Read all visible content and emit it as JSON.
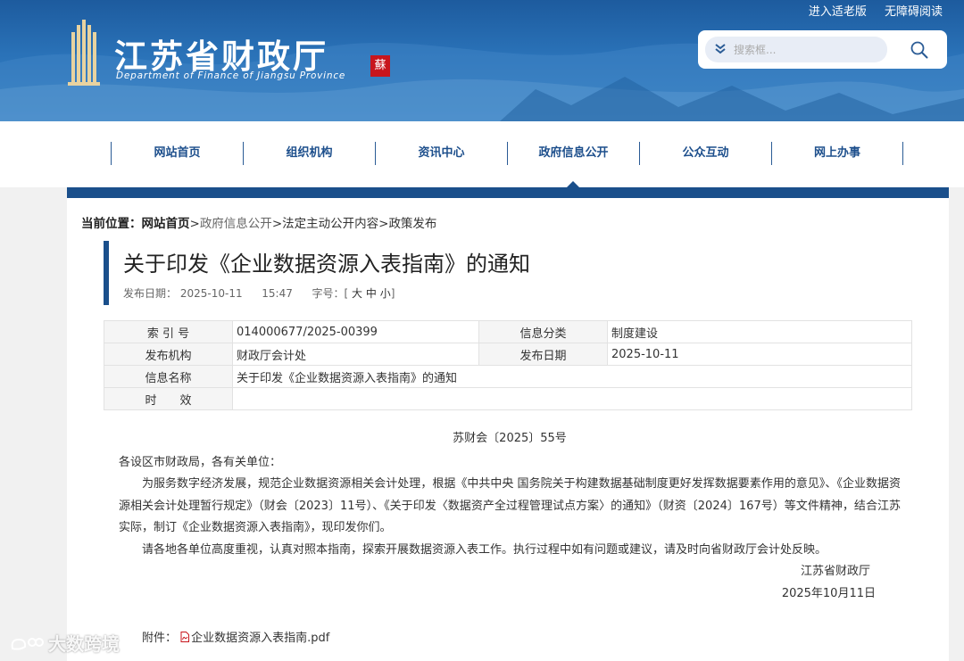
{
  "header": {
    "top_links": [
      "进入适老版",
      "无障碍阅读"
    ],
    "site_title": "江苏省财政厅",
    "site_subtitle": "Department of Finance of Jiangsu Province",
    "seal_char": "蘇",
    "search_placeholder": "搜索框..."
  },
  "nav": {
    "items": [
      "网站首页",
      "组织机构",
      "资讯中心",
      "政府信息公开",
      "公众互动",
      "网上办事"
    ],
    "active_index": 3
  },
  "breadcrumb": {
    "label": "当前位置：",
    "home": "网站首页",
    "sep": ">",
    "items": [
      "政府信息公开",
      "法定主动公开内容",
      "政策发布"
    ]
  },
  "article": {
    "title": "关于印发《企业数据资源入表指南》的通知",
    "publish_label": "发布日期：",
    "publish_date": "2025-10-11",
    "publish_time": "15:47",
    "fontsize_label": "字号：",
    "fontsize_open": "[",
    "fontsize_options": [
      "大",
      "中",
      "小"
    ],
    "fontsize_close": "]"
  },
  "info_table": {
    "index_label": "索 引 号",
    "index_value": "014000677/2025-00399",
    "category_label": "信息分类",
    "category_value": "制度建设",
    "publisher_label": "发布机构",
    "publisher_value": "财政厅会计处",
    "date_label": "发布日期",
    "date_value": "2025-10-11",
    "name_label": "信息名称",
    "name_value": "关于印发《企业数据资源入表指南》的通知",
    "validity_label": "时　　效",
    "validity_value": ""
  },
  "body": {
    "doc_number": "苏财会〔2025〕55号",
    "salutation": "各设区市财政局，各有关单位：",
    "paragraph1": "为服务数字经济发展，规范企业数据资源相关会计处理，根据《中共中央 国务院关于构建数据基础制度更好发挥数据要素作用的意见》、《企业数据资源相关会计处理暂行规定》（财会〔2023〕11号）、《关于印发〈数据资产全过程管理试点方案〉的通知》（财资〔2024〕167号）等文件精神，结合江苏实际，制订《企业数据资源入表指南》，现印发你们。",
    "paragraph2": "请各地各单位高度重视，认真对照本指南，探索开展数据资源入表工作。执行过程中如有问题或建议，请及时向省财政厅会计处反映。",
    "signature": "江苏省财政厅",
    "date": "2025年10月11日"
  },
  "attachment": {
    "label": "附件：",
    "file_name": "企业数据资源入表指南.pdf"
  },
  "watermark": {
    "text": "大数跨境"
  },
  "colors": {
    "header_blue": "#2a72b8",
    "nav_text": "#1d4f8c",
    "accent_bar": "#1a4f8b",
    "seal_red": "#c8161d"
  }
}
